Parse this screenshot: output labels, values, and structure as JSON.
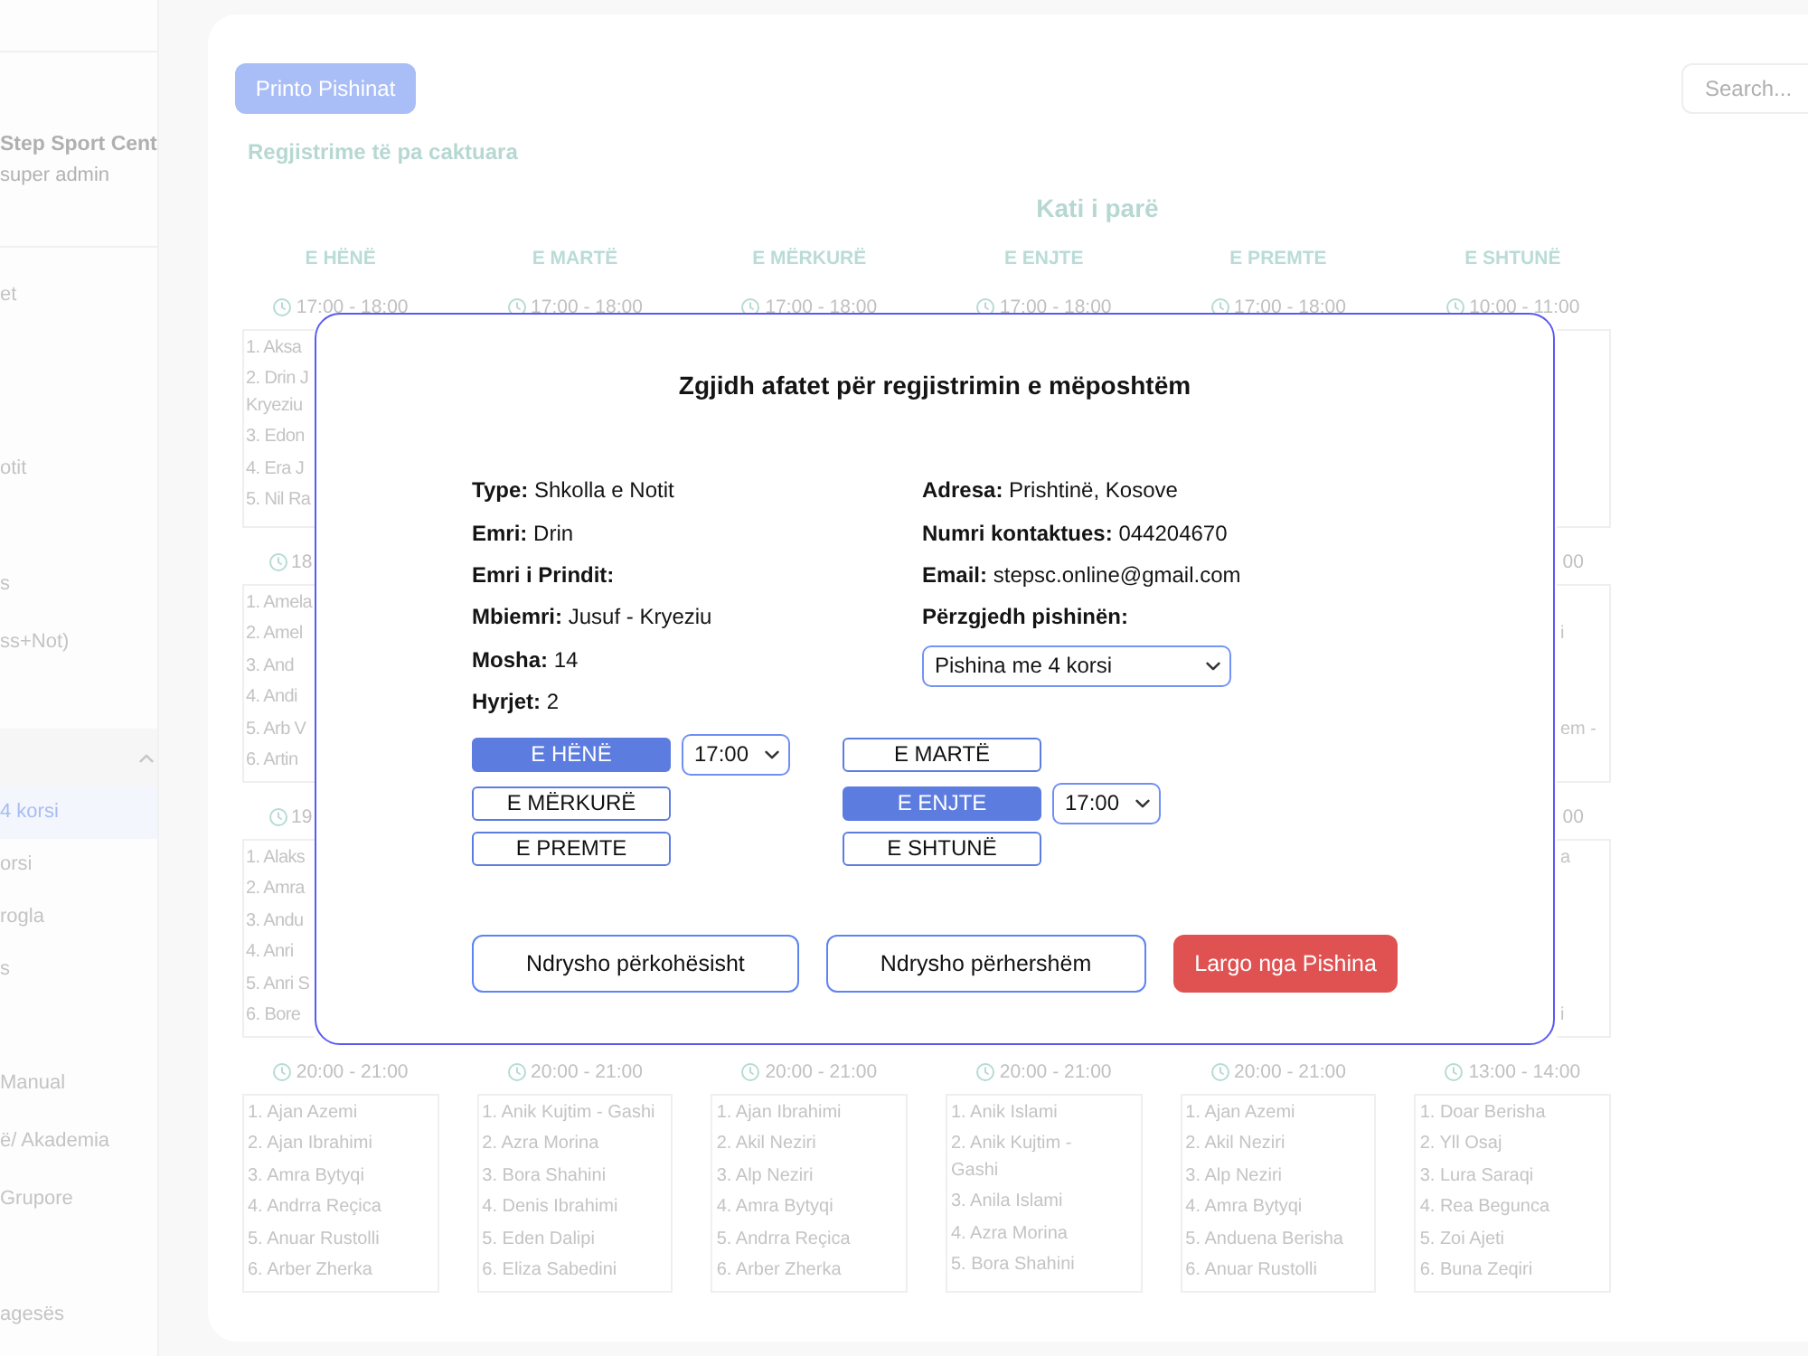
{
  "sidebar": {
    "brand": "Step Sport Cent",
    "role": "super admin",
    "items": [
      {
        "label": "et",
        "selected": false,
        "expanded": false
      },
      {
        "label": "otit",
        "selected": false,
        "expanded": false
      },
      {
        "label": "s",
        "selected": false,
        "expanded": false
      },
      {
        "label": "ss+Not)",
        "selected": false,
        "expanded": false
      },
      {
        "expanded": true,
        "children": [
          {
            "label": "4 korsi",
            "selected": true
          },
          {
            "label": "orsi",
            "selected": false
          },
          {
            "label": "rogla",
            "selected": false
          },
          {
            "label": "s",
            "selected": false
          }
        ]
      },
      {
        "label": "Manual",
        "selected": false,
        "expanded": false
      },
      {
        "label": "ë/ Akademia",
        "selected": false,
        "expanded": false
      },
      {
        "label": "Grupore",
        "selected": false,
        "expanded": false
      },
      {
        "label": "agesës",
        "selected": false,
        "expanded": false
      }
    ]
  },
  "toolbar": {
    "print_button": "Printo Pishinat",
    "search": {
      "placeholder": "Search..."
    }
  },
  "unassigned_heading": "Regjistrime të pa caktuara",
  "schedule": {
    "title": "Kati i parë",
    "days": [
      "E HËNË",
      "E MARTË",
      "E MËRKURË",
      "E ENJTE",
      "E PREMTE",
      "E SHTUNË"
    ],
    "rows": [
      {
        "times": [
          {
            "text": "17:00 - 18:00",
            "kind": "full"
          },
          {
            "text": "17:00 - 18:00",
            "kind": "full"
          },
          {
            "text": "17:00 - 18:00",
            "kind": "full"
          },
          {
            "text": "17:00 - 18:00",
            "kind": "full"
          },
          {
            "text": "17:00 - 18:00",
            "kind": "full"
          },
          {
            "text": "10:00 - 11:00",
            "kind": "full"
          }
        ],
        "lists": [
          {
            "kind": "left_edge",
            "names": [
              "1. Aksa",
              [
                "2. Drin J",
                "Kryeziu"
              ],
              "3. Edon",
              "4. Era J",
              "5. Nil Ra"
            ]
          },
          {
            "kind": "right_edge"
          }
        ]
      },
      {
        "times": [
          {
            "text": "18",
            "kind": "left_edge"
          },
          {
            "text": "00",
            "kind": "right_edge"
          }
        ],
        "lists": [
          {
            "kind": "left_edge",
            "names": [
              "1. Amela",
              "2. Amel",
              "3. And",
              "4. Andi",
              "5. Arb V",
              "6. Artin"
            ]
          },
          {
            "kind": "right_edge",
            "names": [
              "i",
              "em -"
            ]
          }
        ]
      },
      {
        "times": [
          {
            "text": "19",
            "kind": "left_edge"
          },
          {
            "text": "00",
            "kind": "right_edge"
          }
        ],
        "lists": [
          {
            "kind": "left_edge",
            "names": [
              "1. Alaks",
              "2. Amra",
              "3. Andu",
              "4. Anri",
              "5. Anri S",
              "6. Bore"
            ]
          },
          {
            "kind": "right_edge",
            "names": [
              "a",
              "i"
            ]
          }
        ]
      },
      {
        "times": [
          {
            "text": "20:00 - 21:00",
            "kind": "full"
          },
          {
            "text": "20:00 - 21:00",
            "kind": "full"
          },
          {
            "text": "20:00 - 21:00",
            "kind": "full"
          },
          {
            "text": "20:00 - 21:00",
            "kind": "full"
          },
          {
            "text": "20:00 - 21:00",
            "kind": "full"
          },
          {
            "text": "13:00 - 14:00",
            "kind": "full"
          }
        ],
        "lists": [
          {
            "kind": "full",
            "names": [
              "1. Ajan Azemi",
              "2. Ajan Ibrahimi",
              "3. Amra Bytyqi",
              "4. Andrra Reçica",
              "5. Anuar Rustolli",
              "6. Arber Zherka"
            ]
          },
          {
            "kind": "full",
            "names": [
              "1. Anik Kujtim - Gashi",
              "2. Azra Morina",
              "3. Bora Shahini",
              "4. Denis Ibrahimi",
              "5. Eden Dalipi",
              "6. Eliza Sabedini"
            ]
          },
          {
            "kind": "full",
            "names": [
              "1. Ajan Ibrahimi",
              "2. Akil Neziri",
              "3. Alp Neziri",
              "4. Amra Bytyqi",
              "5. Andrra Reçica",
              "6. Arber Zherka"
            ]
          },
          {
            "kind": "full",
            "names": [
              "1. Anik Islami",
              [
                "2. Anik Kujtim -",
                "Gashi"
              ],
              "3. Anila Islami",
              "4. Azra Morina",
              "5. Bora Shahini"
            ]
          },
          {
            "kind": "full",
            "names": [
              "1. Ajan Azemi",
              "2. Akil Neziri",
              "3. Alp Neziri",
              "4. Amra Bytyqi",
              "5. Anduena Berisha",
              "6. Anuar Rustolli"
            ]
          },
          {
            "kind": "full",
            "names": [
              "1. Doar Berisha",
              "2. Yll Osaj",
              "3. Lura Saraqi",
              "4. Rea Begunca",
              "5. Zoi Ajeti",
              "6. Buna Zeqiri"
            ]
          }
        ]
      }
    ]
  },
  "dialog": {
    "title": "Zgjidh afatet për regjistrimin e mëposhtëm",
    "details_left": [
      {
        "label": "Type:",
        "value": "Shkolla e Notit"
      },
      {
        "label": "Emri:",
        "value": "Drin"
      },
      {
        "label": "Emri i Prindit:"
      },
      {
        "label": "Mbiemri:",
        "value": "Jusuf - Kryeziu"
      },
      {
        "label": "Mosha:",
        "value": "14"
      },
      {
        "label": "Hyrjet:",
        "value": "2"
      }
    ],
    "details_right": [
      {
        "label": "Adresa:",
        "value": "Prishtinë, Kosove"
      },
      {
        "label": "Numri kontaktues:",
        "value": "044204670"
      },
      {
        "label": "Email:",
        "value": "stepsc.online@gmail.com"
      },
      {
        "label": "Përzgjedh pishinën:"
      }
    ],
    "pool_select": {
      "value": "Pishina me 4 korsi"
    },
    "days": [
      {
        "label": "E HËNË",
        "selected": true,
        "time": "17:00"
      },
      {
        "label": "E MARTË",
        "selected": false
      },
      {
        "label": "E MËRKURË",
        "selected": false
      },
      {
        "label": "E ENJTE",
        "selected": true,
        "time": "17:00"
      },
      {
        "label": "E PREMTE",
        "selected": false
      },
      {
        "label": "E SHTUNË",
        "selected": false
      }
    ],
    "actions": [
      {
        "label": "Ndrysho përkohësisht",
        "kind": "outline"
      },
      {
        "label": "Ndrysho përhershëm",
        "kind": "outline"
      },
      {
        "label": "Largo nga Pishina",
        "kind": "danger"
      }
    ]
  }
}
